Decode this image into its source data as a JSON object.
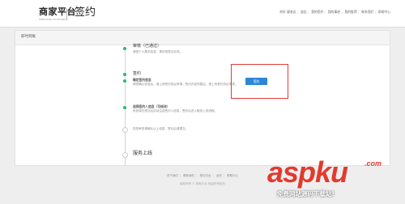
{
  "header": {
    "brand": "商家平台",
    "brand_sub": "MERCHANT PLATFORM",
    "page_name": "签约",
    "nav": [
      "你好 要老志",
      "退出",
      "我的签约",
      "我的事迹",
      "我的推荐",
      "联系我们",
      "帮助中心"
    ]
  },
  "panel": {
    "title": "即时到账",
    "steps": [
      {
        "title": "审核（已通过）",
        "desc": "请您个人基本信息，请尽快提交合同。"
      },
      {
        "title": "签约",
        "desc": ""
      },
      {
        "title": "",
        "desc": "您的审查请确认以上信息，签约后请提交。"
      },
      {
        "title": "服务上线",
        "desc": ""
      }
    ],
    "sign_sections": [
      {
        "title": "确定签约信息",
        "desc": "请您确认信息后，请上传签约协议申请，签约内容完整后，请上传签约协议申请，"
      },
      {
        "title": "选择签约人信息（可修改）",
        "desc": "系统将在提交后自动生成签约人信息，签约后进入服务上线流程。"
      }
    ],
    "cta_label": "签约"
  },
  "footer": {
    "links": [
      "关于我们",
      "联系我们",
      "签约平台",
      "合作",
      "帮助中心"
    ],
    "copyright": "版权所有 © 商家平台 保留所有权利"
  },
  "watermark": {
    "brand": "aspku",
    "dot": ".com",
    "tag": "免费网站源码下载站!"
  },
  "colors": {
    "accent": "#2d86d6",
    "highlight": "#e03a3a",
    "success": "#2eb872",
    "watermark": "#e23a2e"
  }
}
